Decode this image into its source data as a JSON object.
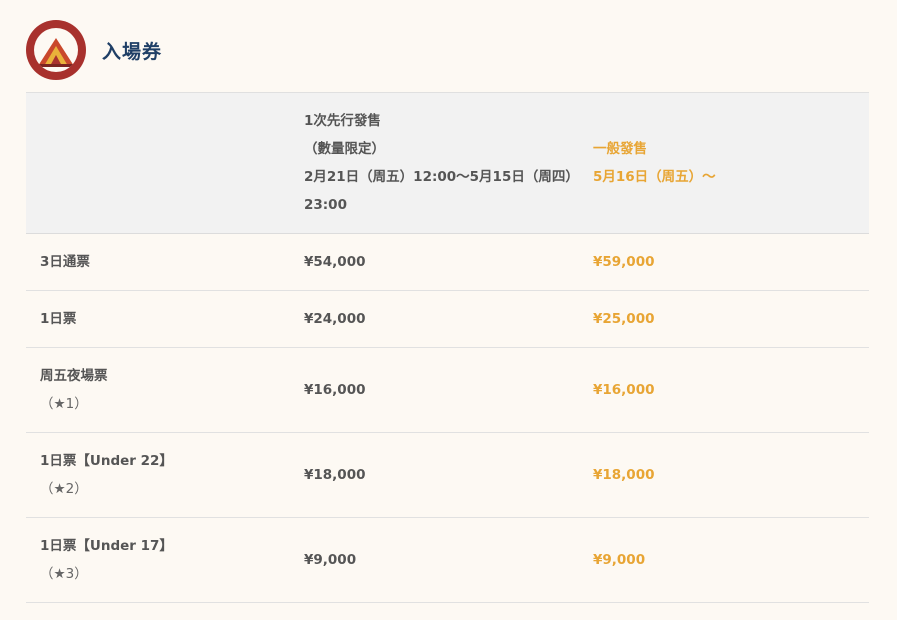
{
  "header": {
    "title": "入場券"
  },
  "table": {
    "columns": [
      "",
      "1次先行發售\n（數量限定）\n2月21日（周五）12:00〜5月15日（周四）23:00",
      "一般發售\n5月16日（周五）〜"
    ],
    "rows": [
      {
        "name": "3日通票",
        "note": "",
        "presale": "¥54,000",
        "general": "¥59,000"
      },
      {
        "name": "1日票",
        "note": "",
        "presale": "¥24,000",
        "general": "¥25,000"
      },
      {
        "name": "周五夜場票",
        "note": "（★1）",
        "presale": "¥16,000",
        "general": "¥16,000"
      },
      {
        "name": "1日票【Under 22】",
        "note": "（★2）",
        "presale": "¥18,000",
        "general": "¥18,000"
      },
      {
        "name": "1日票【Under 17】",
        "note": "（★3）",
        "presale": "¥9,000",
        "general": "¥9,000"
      }
    ]
  },
  "colors": {
    "accent_general": "#e8a534",
    "title": "#1f3f66",
    "logo_ring": "#a8312d"
  },
  "icons": {
    "logo": "festival-mountain-logo-icon"
  }
}
